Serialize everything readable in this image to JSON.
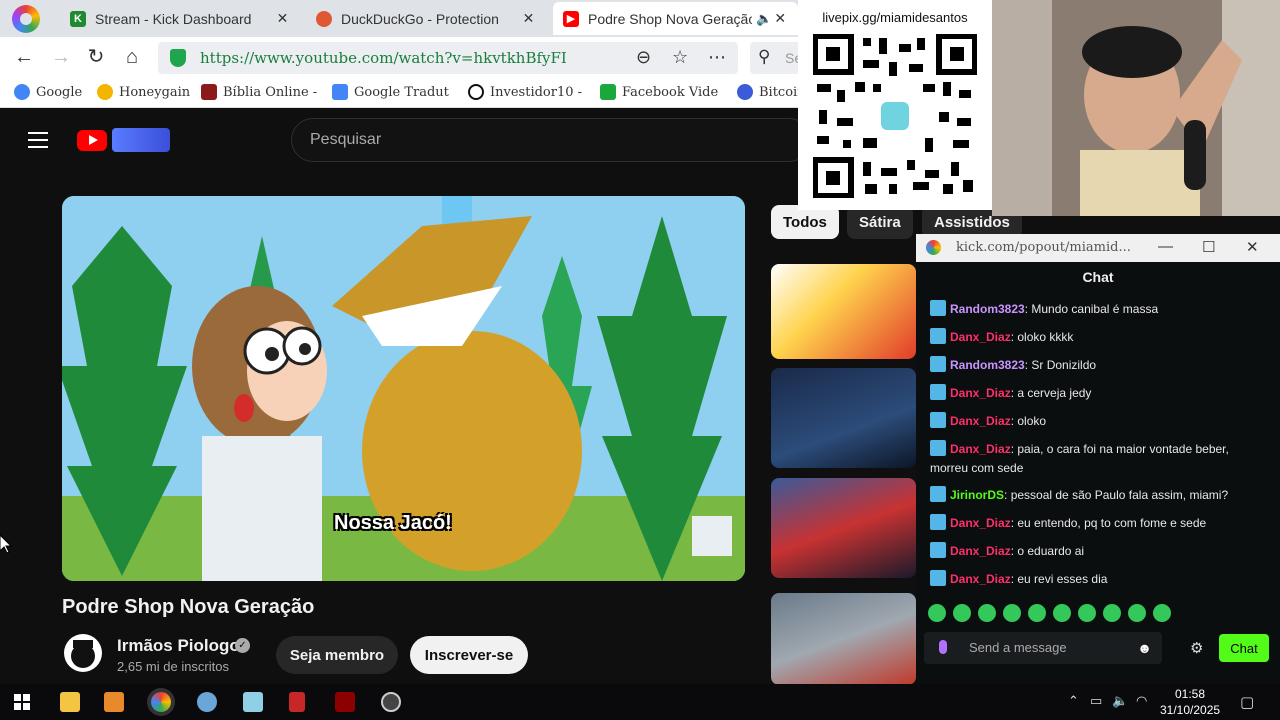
{
  "browser": {
    "tabs": [
      {
        "title": "Stream - Kick Dashboard",
        "favicon": "kick-icon",
        "color": "#53fc18"
      },
      {
        "title": "DuckDuckGo - Protection",
        "favicon": "duckduckgo-icon",
        "color": "#de5833"
      },
      {
        "title": "Podre Shop Nova Geração",
        "favicon": "youtube-icon",
        "color": "#ff0000"
      }
    ],
    "url": "https://www.youtube.com/watch?v=hkvtkhBfyFI",
    "search_placeholder": "Se",
    "bookmarks": [
      {
        "label": "Google",
        "icon": "google-icon",
        "color": "#4285f4"
      },
      {
        "label": "Honeygain",
        "icon": "honeygain-icon",
        "color": "#f4b400"
      },
      {
        "label": "Bíblia Online -",
        "icon": "bible-icon",
        "color": "#8b1a1a"
      },
      {
        "label": "Google Tradut",
        "icon": "translate-icon",
        "color": "#4285f4"
      },
      {
        "label": "Investidor10 -",
        "icon": "investidor-icon",
        "color": "#111111"
      },
      {
        "label": "Facebook Vide",
        "icon": "facebook-icon",
        "color": "#1ba83a"
      },
      {
        "label": "Bitcoin",
        "icon": "bitcoin-icon",
        "color": "#3b5bdb"
      }
    ]
  },
  "youtube": {
    "search_placeholder": "Pesquisar",
    "video_caption": "Nossa Jacó!",
    "video_title": "Podre Shop Nova Geração",
    "channel_name": "Irmãos Piologo",
    "subscribers": "2,65 mi de inscritos",
    "member_label": "Seja membro",
    "subscribe_label": "Inscrever-se",
    "chips": [
      "Todos",
      "Sátira",
      "Assistidos"
    ]
  },
  "overlay": {
    "pix_text": "livepix.gg/miamidesantos"
  },
  "chat": {
    "window_path": "kick.com/popout/miamid...",
    "header": "Chat",
    "messages": [
      {
        "user": "Random3823",
        "color": "purple",
        "text": "Mundo canibal é massa"
      },
      {
        "user": "Danx_Diaz",
        "color": "pink",
        "text": "oloko kkkk"
      },
      {
        "user": "Random3823",
        "color": "purple",
        "text": "Sr Donizildo"
      },
      {
        "user": "Danx_Diaz",
        "color": "pink",
        "text": "a cerveja jedy"
      },
      {
        "user": "Danx_Diaz",
        "color": "pink",
        "text": "oloko"
      },
      {
        "user": "Danx_Diaz",
        "color": "pink",
        "text": "paia, o cara foi na maior vontade beber, morreu com sede"
      },
      {
        "user": "JirinorDS",
        "color": "green",
        "text": "pessoal de são Paulo fala assim, miami?"
      },
      {
        "user": "Danx_Diaz",
        "color": "pink",
        "text": "eu entendo, pq to com fome e sede"
      },
      {
        "user": "Danx_Diaz",
        "color": "pink",
        "text": "o eduardo ai"
      },
      {
        "user": "Danx_Diaz",
        "color": "pink",
        "text": "eu revi esses dia"
      }
    ],
    "send_placeholder": "Send a message",
    "chat_button": "Chat"
  },
  "taskbar": {
    "time": "01:58",
    "date": "31/10/2025"
  }
}
